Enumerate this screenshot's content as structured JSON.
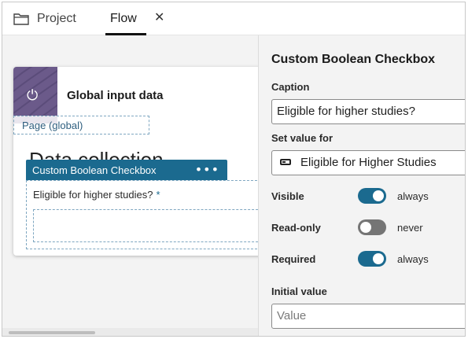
{
  "tabs": {
    "project_label": "Project",
    "flow_label": "Flow",
    "close_glyph": "✕",
    "folder_icon": "folder-icon"
  },
  "canvas": {
    "global_card": {
      "icon": "plug-icon",
      "plug_glyph": "⏻",
      "title": "Global input data",
      "thumb_color": "#6b5a8a"
    },
    "page_label": "Page (global)",
    "background_heading": "Data collection",
    "component": {
      "header": "Custom Boolean Checkbox",
      "menu_glyph": "•••",
      "field_label": "Eligible for higher studies?",
      "required_mark": "*",
      "accent": "#1b6a8f"
    }
  },
  "panel": {
    "title": "Custom Boolean Checkbox",
    "caption_label": "Caption",
    "caption_value": "Eligible for higher studies?",
    "set_value_label": "Set value for",
    "set_value_value": "Eligible for Higher Studies",
    "set_value_icon": "boolean-field-icon",
    "visible": {
      "label": "Visible",
      "state": "always",
      "on": true
    },
    "readonly": {
      "label": "Read-only",
      "state": "never",
      "on": false
    },
    "required": {
      "label": "Required",
      "state": "always",
      "on": true
    },
    "initial_value_label": "Initial value",
    "initial_value_placeholder": "Value"
  }
}
